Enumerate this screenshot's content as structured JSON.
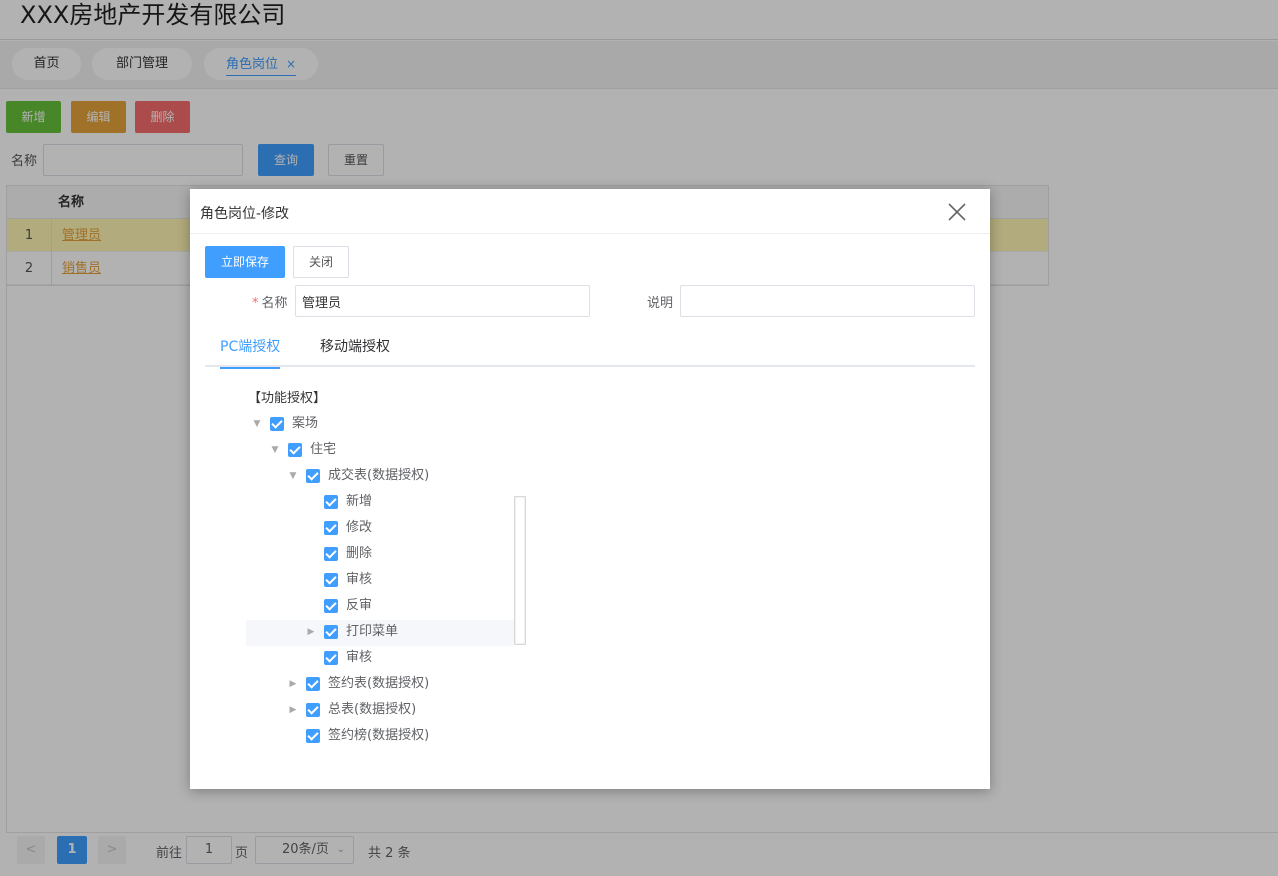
{
  "app": {
    "title": "XXX房地产开发有限公司",
    "nav_tabs": [
      "首页",
      "部门管理",
      "角色岗位"
    ],
    "active_tab_close": "×"
  },
  "toolbar": {
    "add": "新增",
    "edit": "编辑",
    "delete": "删除"
  },
  "filter": {
    "label": "名称",
    "value": "",
    "query": "查询",
    "reset": "重置"
  },
  "grid": {
    "header": "名称",
    "rows": [
      {
        "index": "1",
        "name": "管理员",
        "selected": true
      },
      {
        "index": "2",
        "name": "销售员",
        "selected": false
      }
    ]
  },
  "pager": {
    "prev": "<",
    "current": "1",
    "next": ">",
    "goto_label": "前往",
    "goto_value": "1",
    "page_unit": "页",
    "page_size": "20条/页",
    "total": "共 2 条"
  },
  "dialog": {
    "title": "角色岗位-修改",
    "save": "立即保存",
    "close": "关闭",
    "name_label": "名称",
    "name_required_mark": "*",
    "name_value": "管理员",
    "desc_label": "说明",
    "desc_value": "",
    "tabs": {
      "pc": "PC端授权",
      "mobile": "移动端授权"
    },
    "section_title": "【功能授权】",
    "tree": {
      "n0": "案场",
      "n1": "住宅",
      "n2": "成交表(数据授权)",
      "n3": "新增",
      "n4": "修改",
      "n5": "删除",
      "n6": "审核",
      "n7": "反审",
      "n8": "打印菜单",
      "n9": "审核",
      "n10": "签约表(数据授权)",
      "n11": "总表(数据授权)",
      "n12": "签约榜(数据授权)"
    },
    "tree_checked": [
      true,
      true,
      true,
      true,
      true,
      true,
      true,
      true,
      true,
      true,
      true,
      true,
      true
    ],
    "tree_expanded": {
      "n0": true,
      "n1": true,
      "n2": true,
      "n8": false,
      "n10": false,
      "n11": false
    }
  },
  "colors": {
    "primary": "#409eff",
    "success": "#67c23a",
    "warning": "#e6a23c",
    "danger": "#f56c6c",
    "row_highlight": "#fff5b4"
  },
  "icons": {
    "dialog_close": "close-icon",
    "tree_expanded": "caret-down-icon",
    "tree_collapsed": "caret-right-icon",
    "page_size_dropdown": "chevron-down-icon"
  }
}
